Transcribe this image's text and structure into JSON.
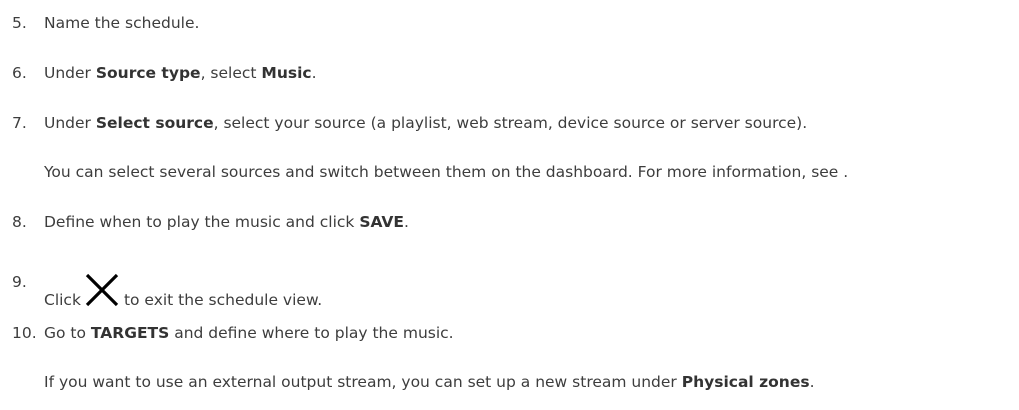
{
  "steps": [
    {
      "number": "5.",
      "parts": [
        "Name the schedule."
      ]
    },
    {
      "number": "6.",
      "parts": [
        "Under ",
        "Source type",
        ", select ",
        "Music",
        "."
      ]
    },
    {
      "number": "7.",
      "parts": [
        "Under ",
        "Select source",
        ", select your source (a playlist, web stream, device source or server source)."
      ],
      "note": "You can select several sources and switch between them on the dashboard. For more information, see ."
    },
    {
      "number": "8.",
      "parts": [
        "Define when to play the music and click ",
        "SAVE",
        "."
      ]
    },
    {
      "number": "9.",
      "before_icon": "Click",
      "icon": "close-icon",
      "after_icon": "to exit the schedule view."
    },
    {
      "number": "10.",
      "parts": [
        "Go to ",
        "TARGETS",
        " and define where to play the music."
      ],
      "note_parts": [
        "If you want to use an external output stream, you can set up a new stream under ",
        "Physical zones",
        "."
      ]
    }
  ]
}
